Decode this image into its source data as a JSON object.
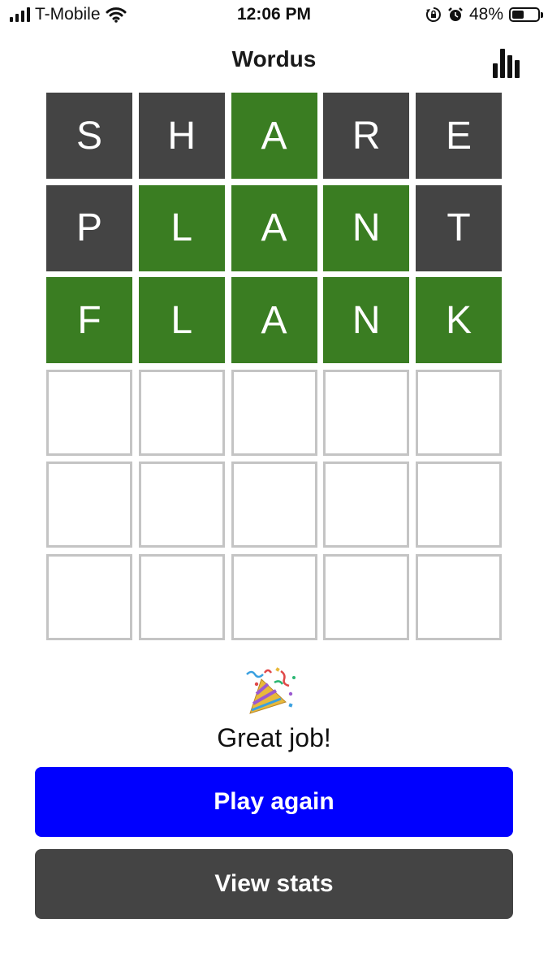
{
  "status_bar": {
    "carrier": "T-Mobile",
    "time": "12:06 PM",
    "battery_percent": "48%",
    "battery_level": 0.48,
    "icons": [
      "signal-icon",
      "wifi-icon",
      "orientation-lock-icon",
      "alarm-icon",
      "battery-icon"
    ]
  },
  "header": {
    "title": "Wordus",
    "stats_icon": "bar-chart-icon"
  },
  "board": {
    "colors": {
      "absent": "#444444",
      "correct": "#3a7d22",
      "empty_border": "#c4c4c4"
    },
    "rows": [
      [
        {
          "letter": "S",
          "state": "absent"
        },
        {
          "letter": "H",
          "state": "absent"
        },
        {
          "letter": "A",
          "state": "correct"
        },
        {
          "letter": "R",
          "state": "absent"
        },
        {
          "letter": "E",
          "state": "absent"
        }
      ],
      [
        {
          "letter": "P",
          "state": "absent"
        },
        {
          "letter": "L",
          "state": "correct"
        },
        {
          "letter": "A",
          "state": "correct"
        },
        {
          "letter": "N",
          "state": "correct"
        },
        {
          "letter": "T",
          "state": "absent"
        }
      ],
      [
        {
          "letter": "F",
          "state": "correct"
        },
        {
          "letter": "L",
          "state": "correct"
        },
        {
          "letter": "A",
          "state": "correct"
        },
        {
          "letter": "N",
          "state": "correct"
        },
        {
          "letter": "K",
          "state": "correct"
        }
      ],
      [
        {
          "letter": "",
          "state": "empty"
        },
        {
          "letter": "",
          "state": "empty"
        },
        {
          "letter": "",
          "state": "empty"
        },
        {
          "letter": "",
          "state": "empty"
        },
        {
          "letter": "",
          "state": "empty"
        }
      ],
      [
        {
          "letter": "",
          "state": "empty"
        },
        {
          "letter": "",
          "state": "empty"
        },
        {
          "letter": "",
          "state": "empty"
        },
        {
          "letter": "",
          "state": "empty"
        },
        {
          "letter": "",
          "state": "empty"
        }
      ],
      [
        {
          "letter": "",
          "state": "empty"
        },
        {
          "letter": "",
          "state": "empty"
        },
        {
          "letter": "",
          "state": "empty"
        },
        {
          "letter": "",
          "state": "empty"
        },
        {
          "letter": "",
          "state": "empty"
        }
      ]
    ]
  },
  "result": {
    "icon": "party-popper-icon",
    "message": "Great job!"
  },
  "actions": {
    "play_again_label": "Play again",
    "play_again_color": "#0000ff",
    "view_stats_label": "View stats",
    "view_stats_color": "#444444"
  }
}
